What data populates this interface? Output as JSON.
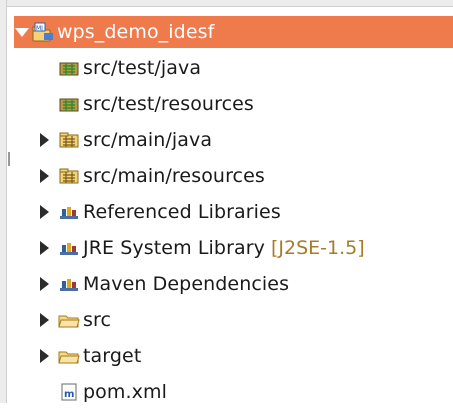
{
  "project": {
    "name": "wps_demo_idesf"
  },
  "tree": {
    "items": [
      {
        "label": "src/test/java",
        "icon": "source-folder-icon"
      },
      {
        "label": "src/test/resources",
        "icon": "source-folder-icon"
      },
      {
        "label": "src/main/java",
        "icon": "source-folder-icon"
      },
      {
        "label": "src/main/resources",
        "icon": "source-folder-icon"
      },
      {
        "label": "Referenced Libraries",
        "icon": "library-icon"
      },
      {
        "label": "JRE System Library",
        "suffix": "[J2SE-1.5]",
        "icon": "library-icon"
      },
      {
        "label": "Maven Dependencies",
        "icon": "library-icon"
      },
      {
        "label": "src",
        "icon": "folder-icon"
      },
      {
        "label": "target",
        "icon": "folder-icon"
      },
      {
        "label": "pom.xml",
        "icon": "maven-pom-icon"
      }
    ]
  },
  "colors": {
    "selection": "#ef7a4c",
    "decoration": "#a67c28"
  }
}
